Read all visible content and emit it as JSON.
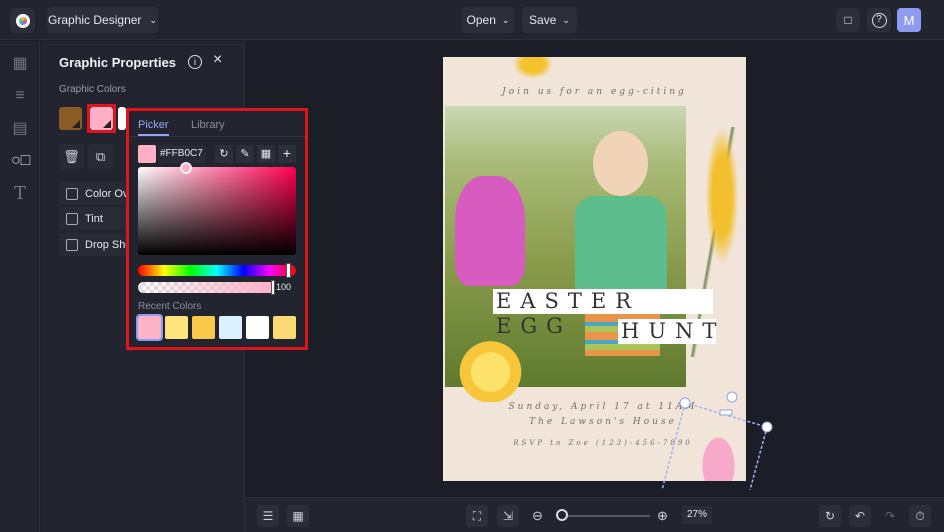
{
  "topbar": {
    "app_menu": "Graphic Designer",
    "open": "Open",
    "save": "Save",
    "avatar": "M"
  },
  "panel": {
    "title": "Graphic Properties",
    "colors_label": "Graphic Colors",
    "options": [
      "Color Ov",
      "Tint",
      "Drop Sho"
    ]
  },
  "picker": {
    "tabs": [
      "Picker",
      "Library"
    ],
    "hex": "#FFB0C7",
    "opacity": "100",
    "recent_label": "Recent Colors",
    "recent": [
      "#fbb3c8",
      "#fde37a",
      "#fbc94a",
      "#dcf1ff",
      "#ffffff",
      "#fdd976"
    ],
    "graphic_colors": [
      "#8c5a25",
      "#ffb0c7",
      "#ffffff"
    ]
  },
  "poster": {
    "intro": "Join us for an egg-citing",
    "title1": "EASTER EGG",
    "title2": "HUNT",
    "date": "Sunday, April 17 at 11AM",
    "place": "The Lawson's House",
    "rsvp": "RSVP to Zoe (123)-456-7890"
  },
  "bottom": {
    "zoom": "27%"
  },
  "zoom_level": 0.27
}
